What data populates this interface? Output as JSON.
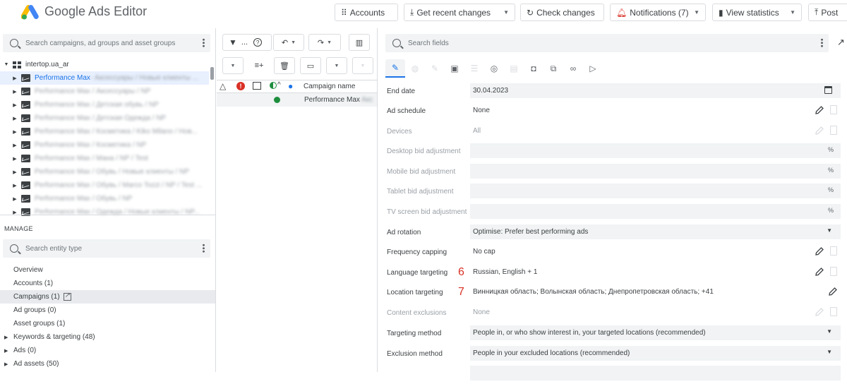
{
  "app": {
    "title": "Google Ads Editor"
  },
  "toolbar": {
    "accounts": "Accounts",
    "get_recent": "Get recent changes",
    "check": "Check changes",
    "notifications": "Notifications (7)",
    "view_stats": "View statistics",
    "post": "Post"
  },
  "tree": {
    "search_placeholder": "Search campaigns, ad groups and asset groups",
    "account": "intertop.ua_ar",
    "items": [
      {
        "label": "Performance Max",
        "suffix": " - Аксессуары / Новые клиенты ..."
      },
      {
        "label": "Performance Max / Аксессуары / NP"
      },
      {
        "label": "Performance Max / Детская обувь / NP"
      },
      {
        "label": "Performance Max / Детская Одежда / NP"
      },
      {
        "label": "Performance Max / Косметика / Kiko Milano / Нов..."
      },
      {
        "label": "Performance Max / Косметика / NP"
      },
      {
        "label": "Performance Max / Мана / NP / Test"
      },
      {
        "label": "Performance Max / Обувь / Новые клиенты / NP"
      },
      {
        "label": "Performance Max / Обувь / Marco Tozzi / NP / Test ..."
      },
      {
        "label": "Performance Max / Обувь / NP"
      },
      {
        "label": "Performance Max / Одежда / Новые клиенты / NP..."
      }
    ]
  },
  "manage": {
    "heading": "MANAGE",
    "search_placeholder": "Search entity type",
    "items": [
      "Overview",
      "Accounts (1)",
      "Campaigns (1)",
      "Ad groups (0)",
      "Asset groups (1)",
      "Keywords & targeting (48)",
      "Ads (0)",
      "Ad assets (50)"
    ]
  },
  "grid": {
    "filter_ellipsis": "...",
    "column_campaign": "Campaign name",
    "row_campaign": "Performance Max",
    "row_suffix": " - Акс"
  },
  "props": {
    "search_placeholder": "Search fields",
    "rows": [
      {
        "label": "End date",
        "value": "30.04.2023"
      },
      {
        "label": "Ad schedule",
        "value": "None"
      },
      {
        "label": "Devices",
        "value": "All"
      },
      {
        "label": "Desktop bid adjustment",
        "value": "",
        "unit": "%"
      },
      {
        "label": "Mobile bid adjustment",
        "value": "",
        "unit": "%"
      },
      {
        "label": "Tablet bid adjustment",
        "value": "",
        "unit": "%"
      },
      {
        "label": "TV screen bid adjustment",
        "value": "",
        "unit": "%"
      },
      {
        "label": "Ad rotation",
        "value": "Optimise: Prefer best performing ads"
      },
      {
        "label": "Frequency capping",
        "value": "No cap"
      },
      {
        "label": "Language targeting",
        "value": "Russian, English + 1",
        "marker": "6"
      },
      {
        "label": "Location targeting",
        "value": "Винницкая область; Волынская область; Днепропетровская область; +41",
        "marker": "7"
      },
      {
        "label": "Content exclusions",
        "value": "None"
      },
      {
        "label": "Targeting method",
        "value": "People in, or who show interest in, your targeted locations (recommended)"
      },
      {
        "label": "Exclusion method",
        "value": "People in your excluded locations (recommended)"
      }
    ]
  },
  "colors": {
    "accent": "#1a73e8",
    "marker": "#d93025",
    "status_green": "#1e8e3e",
    "error_red": "#d93025"
  }
}
